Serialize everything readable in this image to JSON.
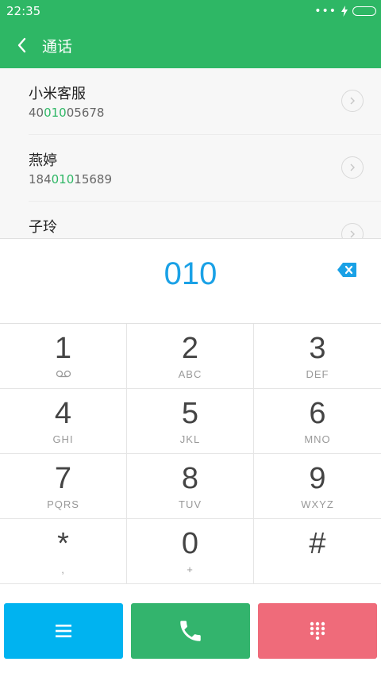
{
  "status_bar": {
    "time": "22:35"
  },
  "header": {
    "title": "通话"
  },
  "results": [
    {
      "name": "小米客服",
      "number_before": "40",
      "number_match": "010",
      "number_after": "05678"
    },
    {
      "name": "燕婷",
      "number_before": "184",
      "number_match": "010",
      "number_after": "15689"
    },
    {
      "name": "子玲",
      "number_before": "",
      "number_match": "",
      "number_after": ""
    }
  ],
  "dialer": {
    "input_value": "010"
  },
  "keypad": [
    {
      "digit": "1",
      "letters": ""
    },
    {
      "digit": "2",
      "letters": "ABC"
    },
    {
      "digit": "3",
      "letters": "DEF"
    },
    {
      "digit": "4",
      "letters": "GHI"
    },
    {
      "digit": "5",
      "letters": "JKL"
    },
    {
      "digit": "6",
      "letters": "MNO"
    },
    {
      "digit": "7",
      "letters": "PQRS"
    },
    {
      "digit": "8",
      "letters": "TUV"
    },
    {
      "digit": "9",
      "letters": "WXYZ"
    },
    {
      "digit": "*",
      "letters": ","
    },
    {
      "digit": "0",
      "letters": "+"
    },
    {
      "digit": "#",
      "letters": ""
    }
  ],
  "colors": {
    "header_green": "#2eb765",
    "dial_blue": "#1aa1e6",
    "menu_button": "#00b3f0",
    "call_button": "#33b46d",
    "keypad_button": "#ef6b7a"
  },
  "icons": {
    "back": "chevron-left-icon",
    "voicemail": "voicemail-icon",
    "backspace": "backspace-icon",
    "menu": "menu-icon",
    "call": "phone-icon",
    "keypad": "dialpad-icon",
    "detail": "chevron-right-circle-icon"
  }
}
